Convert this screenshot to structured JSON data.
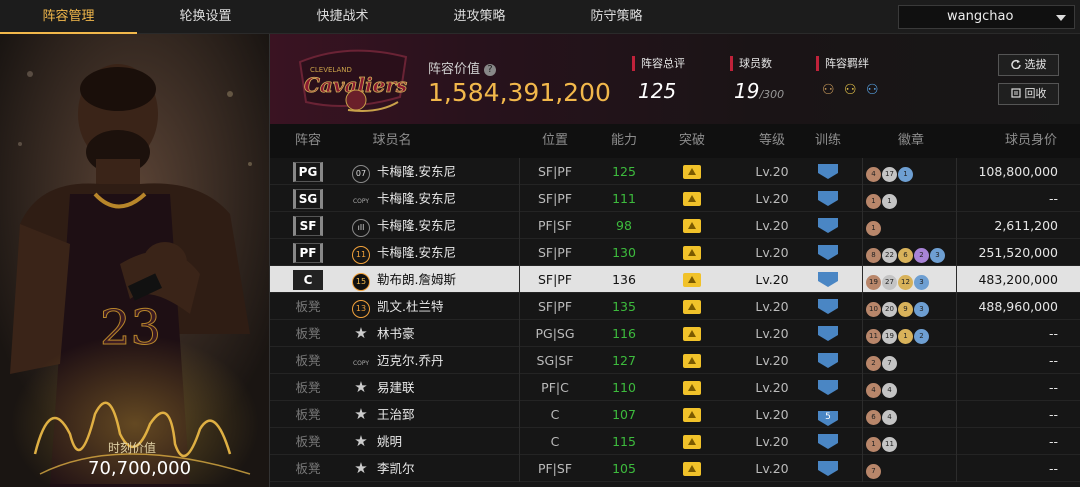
{
  "nav": {
    "tabs": [
      {
        "label": "阵容管理",
        "active": true
      },
      {
        "label": "轮换设置",
        "active": false
      },
      {
        "label": "快捷战术",
        "active": false
      },
      {
        "label": "进攻策略",
        "active": false
      },
      {
        "label": "防守策略",
        "active": false
      }
    ],
    "user": "wangchao"
  },
  "featured": {
    "value_label": "时刻价值",
    "value": "70,700,000"
  },
  "header": {
    "team_logo": "cavaliers-logo",
    "team_value_label": "阵容价值",
    "team_value": "1,584,391,200",
    "total_rating_label": "阵容总评",
    "total_rating": "125",
    "player_count_label": "球员数",
    "player_count": "19",
    "player_count_max": "/300",
    "bonds_label": "阵容羁绊",
    "select_button": "选拔",
    "recycle_button": "回收"
  },
  "columns": [
    "阵容",
    "球员名",
    "位置",
    "能力",
    "突破",
    "等级",
    "训练",
    "徽章",
    "球员身价"
  ],
  "players": [
    {
      "slot": "PG",
      "starter": true,
      "jersey": "07",
      "jersey_style": "plain",
      "name": "卡梅隆.安东尼",
      "position": "SF|PF",
      "rating": "125",
      "level": "Lv.20",
      "training": "",
      "badges": [
        [
          "4",
          "h-br"
        ],
        [
          "17",
          "h-si"
        ],
        [
          "1",
          "h-bl"
        ]
      ],
      "value": "108,800,000"
    },
    {
      "slot": "SG",
      "starter": true,
      "jersey": "COPY",
      "jersey_style": "copy",
      "name": "卡梅隆.安东尼",
      "position": "SF|PF",
      "rating": "111",
      "level": "Lv.20",
      "training": "",
      "badges": [
        [
          "1",
          "h-br"
        ],
        [
          "1",
          "h-si"
        ]
      ],
      "value": "--"
    },
    {
      "slot": "SF",
      "starter": true,
      "jersey": "ıll",
      "jersey_style": "plain",
      "name": "卡梅隆.安东尼",
      "position": "PF|SF",
      "rating": "98",
      "level": "Lv.20",
      "training": "",
      "badges": [
        [
          "1",
          "h-br"
        ]
      ],
      "value": "2,611,200"
    },
    {
      "slot": "PF",
      "starter": true,
      "jersey": "11",
      "jersey_style": "gold",
      "name": "卡梅隆.安东尼",
      "position": "SF|PF",
      "rating": "130",
      "level": "Lv.20",
      "training": "",
      "badges": [
        [
          "8",
          "h-br"
        ],
        [
          "22",
          "h-si"
        ],
        [
          "6",
          "h-go"
        ],
        [
          "2",
          "h-pu"
        ],
        [
          "3",
          "h-bl"
        ]
      ],
      "value": "251,520,000"
    },
    {
      "slot": "C",
      "starter": true,
      "selected": true,
      "jersey": "15",
      "jersey_style": "gold",
      "name": "勒布朗.詹姆斯",
      "position": "SF|PF",
      "rating": "136",
      "level": "Lv.20",
      "training": "",
      "badges": [
        [
          "19",
          "h-br"
        ],
        [
          "27",
          "h-si"
        ],
        [
          "12",
          "h-go"
        ],
        [
          "3",
          "h-bl"
        ]
      ],
      "value": "483,200,000"
    },
    {
      "slot": "板凳",
      "starter": false,
      "jersey": "13",
      "jersey_style": "gold",
      "name": "凯文.杜兰特",
      "position": "SF|PF",
      "rating": "135",
      "level": "Lv.20",
      "training": "",
      "badges": [
        [
          "10",
          "h-br"
        ],
        [
          "20",
          "h-si"
        ],
        [
          "9",
          "h-go"
        ],
        [
          "3",
          "h-bl"
        ]
      ],
      "value": "488,960,000"
    },
    {
      "slot": "板凳",
      "starter": false,
      "jersey": "★",
      "jersey_style": "star",
      "name": "林书豪",
      "position": "PG|SG",
      "rating": "116",
      "level": "Lv.20",
      "training": "",
      "badges": [
        [
          "11",
          "h-br"
        ],
        [
          "19",
          "h-si"
        ],
        [
          "1",
          "h-go"
        ],
        [
          "2",
          "h-bl"
        ]
      ],
      "value": "--"
    },
    {
      "slot": "板凳",
      "starter": false,
      "jersey": "COPY",
      "jersey_style": "copy",
      "name": "迈克尔.乔丹",
      "position": "SG|SF",
      "rating": "127",
      "level": "Lv.20",
      "training": "",
      "badges": [
        [
          "2",
          "h-br"
        ],
        [
          "7",
          "h-si"
        ]
      ],
      "value": "--"
    },
    {
      "slot": "板凳",
      "starter": false,
      "jersey": "★",
      "jersey_style": "star",
      "name": "易建联",
      "position": "PF|C",
      "rating": "110",
      "level": "Lv.20",
      "training": "",
      "badges": [
        [
          "4",
          "h-br"
        ],
        [
          "4",
          "h-si"
        ]
      ],
      "value": "--"
    },
    {
      "slot": "板凳",
      "starter": false,
      "jersey": "★",
      "jersey_style": "star",
      "name": "王治郅",
      "position": "C",
      "rating": "107",
      "level": "Lv.20",
      "training": "5",
      "badges": [
        [
          "6",
          "h-br"
        ],
        [
          "4",
          "h-si"
        ]
      ],
      "value": "--"
    },
    {
      "slot": "板凳",
      "starter": false,
      "jersey": "★",
      "jersey_style": "star",
      "name": "姚明",
      "position": "C",
      "rating": "115",
      "level": "Lv.20",
      "training": "",
      "badges": [
        [
          "1",
          "h-br"
        ],
        [
          "11",
          "h-si"
        ]
      ],
      "value": "--"
    },
    {
      "slot": "板凳",
      "starter": false,
      "jersey": "★",
      "jersey_style": "star",
      "name": "李凯尔",
      "position": "PF|SF",
      "rating": "105",
      "level": "Lv.20",
      "training": "",
      "badges": [
        [
          "7",
          "h-br"
        ]
      ],
      "value": "--"
    }
  ]
}
